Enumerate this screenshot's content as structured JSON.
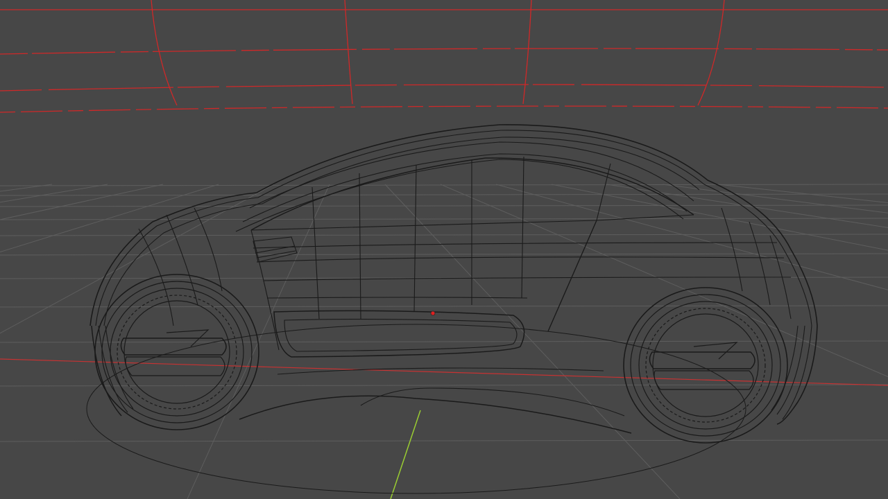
{
  "viewport": {
    "mode": "wireframe",
    "object": "concept car",
    "background_color": "#474747",
    "floor_grid_color": "#5e5e5e",
    "x_axis_color": "#c83232",
    "y_axis_color": "#9acd32",
    "backdrop_wire_color": "#d02828",
    "mesh_wire_color": "#1a1a1a",
    "origin_marker_color": "#e02020"
  }
}
